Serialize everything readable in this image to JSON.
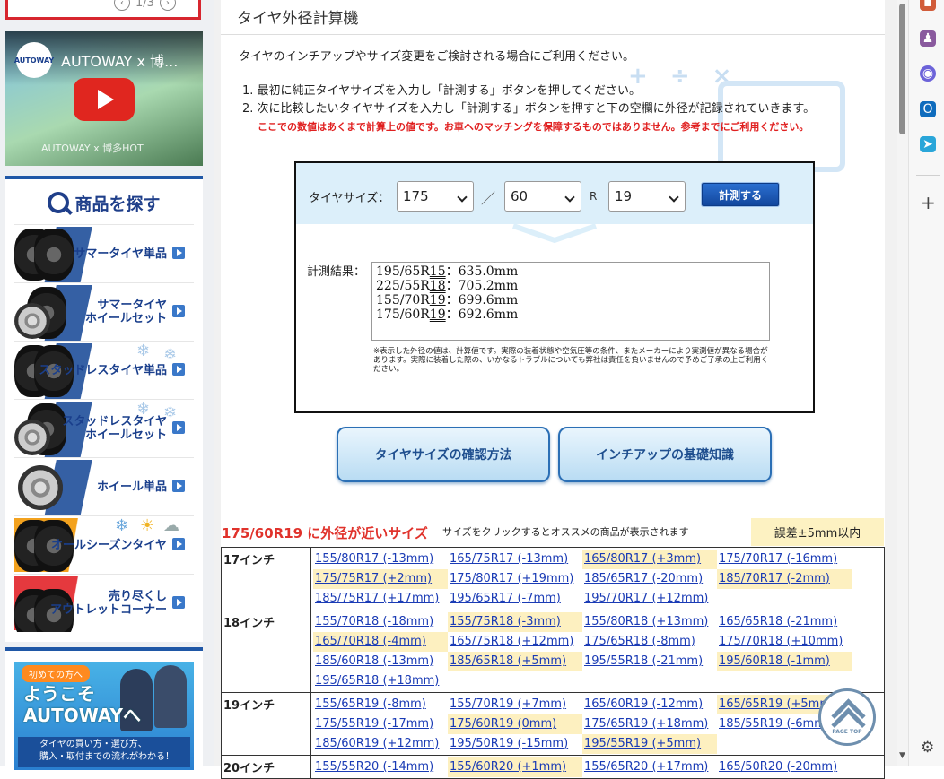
{
  "sidebar": {
    "carousel_counter": "1/3",
    "video": {
      "logo": "AUTOWAY",
      "title": "AUTOWAY x 博...",
      "caption": "AUTOWAY x 博多HOT"
    },
    "search_title": "商品を探す",
    "categories": [
      {
        "label1": "サマータイヤ単品",
        "label2": ""
      },
      {
        "label1": "サマータイヤ",
        "label2": "ホイールセット"
      },
      {
        "label1": "スタッドレスタイヤ単品",
        "label2": ""
      },
      {
        "label1": "スタッドレスタイヤ",
        "label2": "ホイールセット"
      },
      {
        "label1": "ホイール単品",
        "label2": ""
      },
      {
        "label1": "オールシーズンタイヤ",
        "label2": ""
      },
      {
        "label1": "売り尽くし",
        "label2": "アウトレットコーナー"
      }
    ],
    "welcome": {
      "tag": "初めての方へ",
      "title1": "ようこそ",
      "title2": "AUTOWAYへ",
      "sub1": "タイヤの買い方・選び方、",
      "sub2": "購入・取付までの流れがわかる！"
    }
  },
  "main": {
    "title": "タイヤ外径計算機",
    "intro": "タイヤのインチアップやサイズ変更をご検討される場合にご利用ください。",
    "step1": "1. 最初に純正タイヤサイズを入力し「計測する」ボタンを押してください。",
    "step2": "2. 次に比較したいタイヤサイズを入力し「計測する」ボタンを押すと下の空欄に外径が記録されていきます。",
    "warning": "ここでの数値はあくまで計算上の値です。お車へのマッチングを保障するものではありません。参考までにご利用ください。",
    "calc": {
      "size_label": "タイヤサイズ：",
      "width": "175",
      "slash": "／",
      "aspect": "60",
      "r_letter": "R",
      "rim": "19",
      "button": "計測する",
      "result_label": "計測結果：",
      "results": [
        {
          "size": "195/65R",
          "rim": "15",
          "sep": "：",
          "value": "635.0mm"
        },
        {
          "size": "225/55R",
          "rim": "18",
          "sep": "：",
          "value": "705.2mm"
        },
        {
          "size": "155/70R",
          "rim": "19",
          "sep": "：",
          "value": "699.6mm"
        },
        {
          "size": "175/60R",
          "rim": "19",
          "sep": "：",
          "value": "692.6mm"
        }
      ],
      "note": "※表示した外径の値は、計算値です。実際の装着状態や空気圧等の条件、またメーカーにより実測値が異なる場合があります。実際に装着した際の、いかなるトラブルについても弊社は責任を負いませんので予めご了承の上ご利用ください。"
    },
    "buttons": {
      "confirm_size": "タイヤサイズの確認方法",
      "inch_up": "インチアップの基礎知識"
    },
    "near": {
      "title": "175/60R19 に外径が近いサイズ",
      "hint": "サイズをクリックするとオススメの商品が表示されます",
      "tolerance": "誤差±5mm以内"
    },
    "table": [
      {
        "inch": "17インチ",
        "sizes": [
          {
            "t": "155/80R17 (-13mm)",
            "h": false
          },
          {
            "t": "165/75R17 (-13mm)",
            "h": false
          },
          {
            "t": "165/80R17 (+3mm)",
            "h": true
          },
          {
            "t": "175/70R17 (-16mm)",
            "h": false
          },
          {
            "t": "175/75R17 (+2mm)",
            "h": true
          },
          {
            "t": "175/80R17 (+19mm)",
            "h": false
          },
          {
            "t": "185/65R17 (-20mm)",
            "h": false
          },
          {
            "t": "185/70R17 (-2mm)",
            "h": true
          },
          {
            "t": "185/75R17 (+17mm)",
            "h": false
          },
          {
            "t": "195/65R17 (-7mm)",
            "h": false
          },
          {
            "t": "195/70R17 (+12mm)",
            "h": false
          }
        ]
      },
      {
        "inch": "18インチ",
        "sizes": [
          {
            "t": "155/70R18 (-18mm)",
            "h": false
          },
          {
            "t": "155/75R18 (-3mm)",
            "h": true
          },
          {
            "t": "155/80R18 (+13mm)",
            "h": false
          },
          {
            "t": "165/65R18 (-21mm)",
            "h": false
          },
          {
            "t": "165/70R18 (-4mm)",
            "h": true
          },
          {
            "t": "165/75R18 (+12mm)",
            "h": false
          },
          {
            "t": "175/65R18 (-8mm)",
            "h": false
          },
          {
            "t": "175/70R18 (+10mm)",
            "h": false
          },
          {
            "t": "185/60R18 (-13mm)",
            "h": false
          },
          {
            "t": "185/65R18 (+5mm)",
            "h": true
          },
          {
            "t": "195/55R18 (-21mm)",
            "h": false
          },
          {
            "t": "195/60R18 (-1mm)",
            "h": true
          },
          {
            "t": "195/65R18 (+18mm)",
            "h": false
          }
        ]
      },
      {
        "inch": "19インチ",
        "sizes": [
          {
            "t": "155/65R19 (-8mm)",
            "h": false
          },
          {
            "t": "155/70R19 (+7mm)",
            "h": false
          },
          {
            "t": "165/60R19 (-12mm)",
            "h": false
          },
          {
            "t": "165/65R19 (+5mm)",
            "h": true
          },
          {
            "t": "175/55R19 (-17mm)",
            "h": false
          },
          {
            "t": "175/60R19 (0mm)",
            "h": true
          },
          {
            "t": "175/65R19 (+18mm)",
            "h": false
          },
          {
            "t": "185/55R19 (-6mm)",
            "h": false
          },
          {
            "t": "185/60R19 (+12mm)",
            "h": false
          },
          {
            "t": "195/50R19 (-15mm)",
            "h": false
          },
          {
            "t": "195/55R19 (+5mm)",
            "h": true
          }
        ]
      },
      {
        "inch": "20インチ",
        "sizes": [
          {
            "t": "155/55R20 (-14mm)",
            "h": false
          },
          {
            "t": "155/60R20 (+1mm)",
            "h": true
          },
          {
            "t": "155/65R20 (+17mm)",
            "h": false
          },
          {
            "t": "165/50R20 (-20mm)",
            "h": false
          }
        ]
      }
    ],
    "page_top": "PAGE TOP"
  },
  "colors": {
    "brand_blue": "#1f57a6",
    "accent_red": "#e0322b",
    "highlight": "#fdf0c0",
    "link": "#1a3bb5"
  },
  "icons": [
    "search-icon",
    "play-icon",
    "chevron-left-icon",
    "chevron-right-icon",
    "arrow-right-icon",
    "page-top-icon",
    "plus-icon",
    "settings-icon"
  ]
}
